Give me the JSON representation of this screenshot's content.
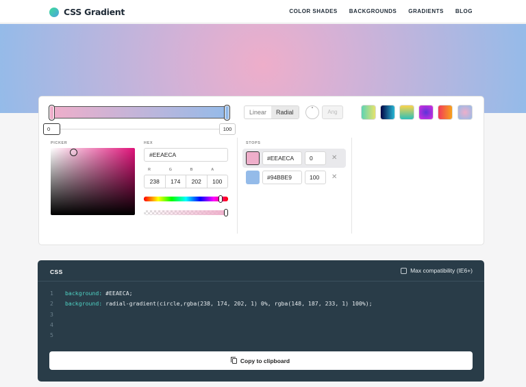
{
  "header": {
    "logo_text": "CSS Gradient",
    "nav": [
      "COLOR SHADES",
      "BACKGROUNDS",
      "GRADIENTS",
      "BLOG"
    ]
  },
  "gradient": {
    "colors": {
      "start": "#EEAECA",
      "end": "#94BBE9"
    },
    "type_options": [
      "Linear",
      "Radial"
    ],
    "type_selected": "Radial",
    "angle_placeholder": "Ang",
    "positions": [
      "0",
      "100"
    ]
  },
  "presets": [
    {
      "name": "preset-1",
      "colors": [
        "#5fd3b3",
        "#e6e36b"
      ]
    },
    {
      "name": "preset-2",
      "colors": [
        "#020344",
        "#28b8d5"
      ]
    },
    {
      "name": "preset-3",
      "colors": [
        "#fcd44b",
        "#2ec0b7"
      ]
    },
    {
      "name": "preset-4",
      "colors": [
        "#d92ee0",
        "#5b34d8"
      ]
    },
    {
      "name": "preset-5",
      "colors": [
        "#f23a5b",
        "#f7a21c"
      ]
    },
    {
      "name": "preset-6",
      "colors": [
        "#eeaeca",
        "#94bbe9"
      ]
    }
  ],
  "picker": {
    "label": "PICKER",
    "hex_label": "HEX",
    "hex_value": "#EEAECA",
    "rgba_labels": [
      "R",
      "G",
      "B",
      "A"
    ],
    "rgba_values": [
      "238",
      "174",
      "202",
      "100"
    ]
  },
  "stops": {
    "label": "STOPS",
    "items": [
      {
        "hex": "#EEAECA",
        "position": "0",
        "color": "#eeaeca"
      },
      {
        "hex": "#94BBE9",
        "position": "100",
        "color": "#94bbe9"
      }
    ]
  },
  "code": {
    "title": "CSS",
    "compat_label": "Max compatibility (IE6+)",
    "line_numbers": [
      "1",
      "2",
      "3",
      "4",
      "5"
    ],
    "lines": [
      {
        "prop": "background:",
        "value": "#EEAECA;"
      },
      {
        "prop": "background:",
        "value": "radial-gradient(circle,rgba(238, 174, 202, 1) 0%, rgba(148, 187, 233, 1) 100%);"
      }
    ],
    "copy_label": "Copy to clipboard"
  }
}
